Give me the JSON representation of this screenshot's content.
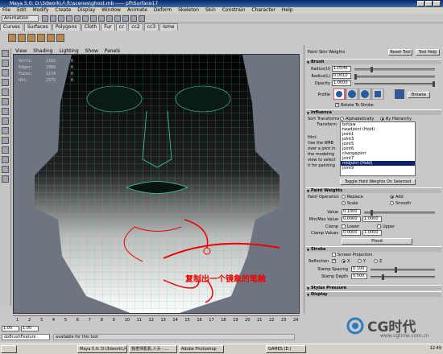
{
  "app": {
    "title": "Maya 5.0: D:\\3dwork\\人头\\scenes\\ghost.mb ----- pfhSurface17",
    "menus": [
      "File",
      "Edit",
      "Modify",
      "Create",
      "Display",
      "Window",
      "Animate",
      "Deform",
      "Skeleton",
      "Skin",
      "Constrain",
      "Character",
      "Help"
    ],
    "mode": "Animation",
    "shelf_tabs": [
      "Curves",
      "Surfaces",
      "Polygons",
      "Cloth",
      "Fur",
      "cc",
      "cc2",
      "cc3",
      "Isme"
    ]
  },
  "viewport": {
    "menus": [
      "View",
      "Shading",
      "Lighting",
      "Show",
      "Panels"
    ],
    "hud": [
      {
        "k": "Verts:",
        "a": "1162",
        "b": "0"
      },
      {
        "k": "Edges:",
        "a": "2360",
        "b": "0"
      },
      {
        "k": "Faces:",
        "a": "1174",
        "b": "0"
      },
      {
        "k": "UVs:",
        "a": "2575",
        "b": "0"
      }
    ],
    "annotation": "复制出一个镜象的笔触",
    "ticks": [
      "1",
      "2",
      "3",
      "4",
      "5",
      "6",
      "7",
      "8",
      "9",
      "10",
      "11",
      "12",
      "13",
      "14",
      "15",
      "16",
      "17",
      "18",
      "19",
      "20",
      "21",
      "22",
      "23",
      "24"
    ]
  },
  "tool": {
    "title": "Paint Skin Weights",
    "reset_label": "Reset Tool",
    "help_label": "Tool Help",
    "brush": {
      "section": "Brush",
      "radius_u_label": "Radius(U)",
      "radius_u": "1.0546",
      "radius_l_label": "Radius(L)",
      "radius_l": "0.0010",
      "opacity_label": "Opacity",
      "opacity": "1.0000",
      "profile_label": "Profile",
      "browse_label": "Browse",
      "rotate_label": "Rotate To Stroke"
    },
    "influence": {
      "section": "Influence",
      "sort_label": "Sort Transforms",
      "sort_alpha": "Alphabetically",
      "sort_hier": "By Hierarchy",
      "transform_label": "Transform",
      "items": [
        "botjaw",
        "headjoint (Hold)",
        "joint1",
        "joint3",
        "joint5",
        "joint6",
        "changejoint",
        "joint7",
        "midjoint (Hold)",
        "joint9"
      ],
      "selected_index": 8,
      "hint": [
        "Hint:",
        "Use the RMB",
        "over a joint in",
        "the modeling",
        "view to select",
        "it for painting"
      ],
      "toggle_label": "Toggle Hold Weights On Selected"
    },
    "weights": {
      "section": "Paint Weights",
      "op_label": "Paint Operation",
      "ops": [
        "Replace",
        "Add",
        "Scale",
        "Smooth"
      ],
      "value_label": "Value",
      "value": "0.1000",
      "minmax_label": "Min/Max Value",
      "min": "0.0000",
      "max": "1.0000",
      "clamp_label": "Clamp",
      "clamp_lower": "Lower",
      "clamp_upper": "Upper",
      "clamp_values_label": "Clamp Values",
      "clamp_min": "0.0000",
      "clamp_max": "1.0000",
      "flood_label": "Flood"
    },
    "stroke": {
      "section": "Stroke",
      "screen_proj": "Screen Projection",
      "reflection_label": "Reflection",
      "axes": [
        "X",
        "Y",
        "Z"
      ],
      "spacing_label": "Stamp Spacing",
      "spacing": "0.100",
      "depth_label": "Stamp Depth",
      "depth": "0.500"
    },
    "pressure_section": "Stylus Pressure",
    "display_section": "Display"
  },
  "bottom": {
    "range_start": "1.00",
    "range_end": "1.00",
    "cmd_value": "doBrushFeature",
    "help_line": "available for this tool"
  },
  "taskbar": {
    "tasks": [
      "Maya 5.0: D:\\3dwork\\人头...",
      "我老师机机.人头 - ...",
      "Adobe Photoshop",
      "GAMES (E:)"
    ],
    "clock": "12:49"
  },
  "watermark": {
    "logo": "CG时代",
    "url": "www.cgtime.com.cn"
  }
}
